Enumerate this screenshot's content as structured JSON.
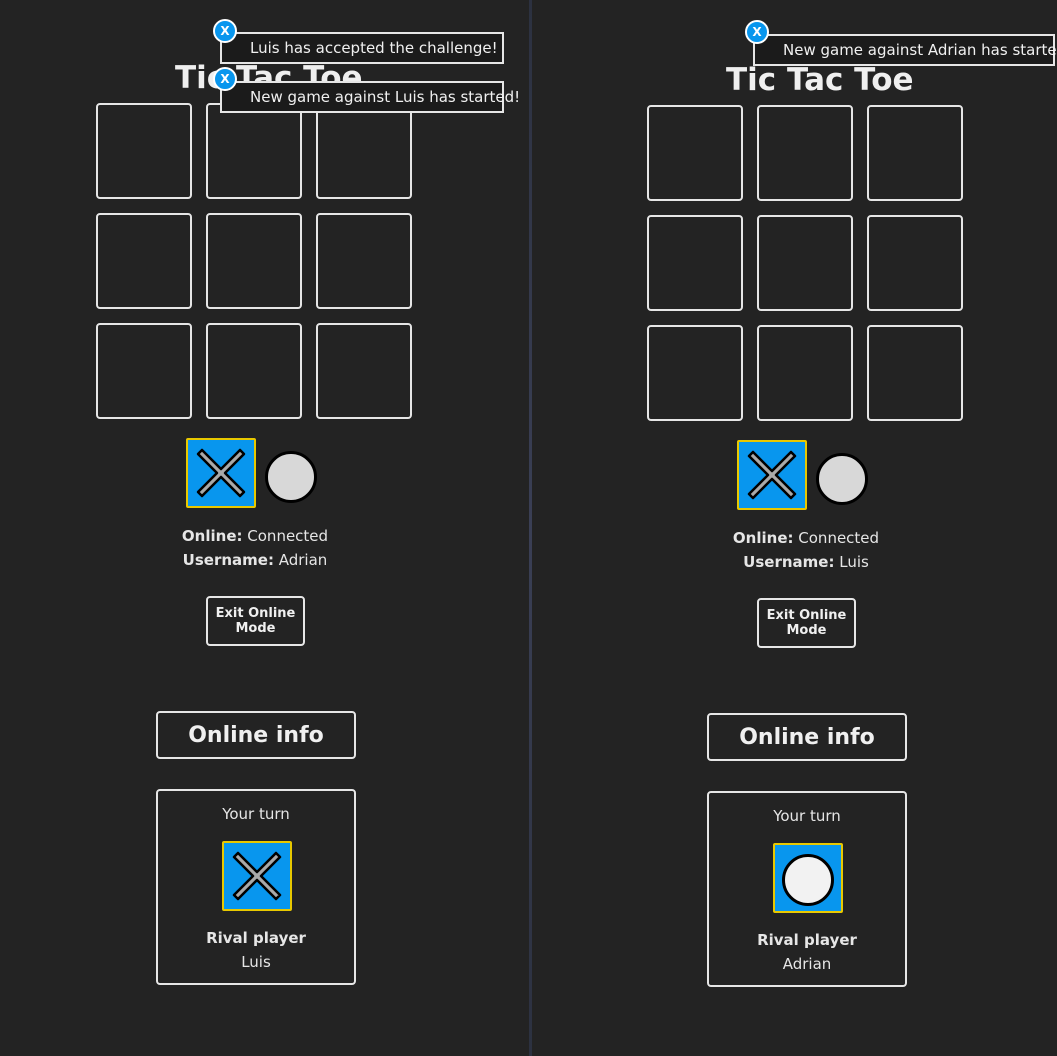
{
  "colors": {
    "background": "#232323",
    "accent_blue": "#0896ee",
    "highlight_yellow": "#e8c800",
    "border": "#e6e6e6"
  },
  "left": {
    "title": "Tic Tac Toe",
    "board": [
      "",
      "",
      "",
      "",
      "",
      "",
      "",
      "",
      ""
    ],
    "symbols": {
      "x_icon": "x-icon",
      "o_icon": "o-icon",
      "selected": "x"
    },
    "online_key": "Online:",
    "online_value": "Connected",
    "username_key": "Username:",
    "username_value": "Adrian",
    "exit_button": "Exit Online Mode",
    "online_info_button": "Online info",
    "turn_panel": {
      "turn_text": "Your turn",
      "turn_symbol": "x",
      "rival_label": "Rival player",
      "rival_name": "Luis"
    },
    "toasts": [
      {
        "close": "X",
        "message": "Luis has accepted the challenge!"
      },
      {
        "close": "X",
        "message": "New game against Luis has started!"
      }
    ]
  },
  "right": {
    "title": "Tic Tac Toe",
    "board": [
      "",
      "",
      "",
      "",
      "",
      "",
      "",
      "",
      ""
    ],
    "symbols": {
      "x_icon": "x-icon",
      "o_icon": "o-icon",
      "selected": "x"
    },
    "online_key": "Online:",
    "online_value": "Connected",
    "username_key": "Username:",
    "username_value": "Luis",
    "exit_button": "Exit Online Mode",
    "online_info_button": "Online info",
    "turn_panel": {
      "turn_text": "Your turn",
      "turn_symbol": "o",
      "rival_label": "Rival player",
      "rival_name": "Adrian"
    },
    "toasts": [
      {
        "close": "X",
        "message": "New game against Adrian has started!"
      }
    ]
  }
}
